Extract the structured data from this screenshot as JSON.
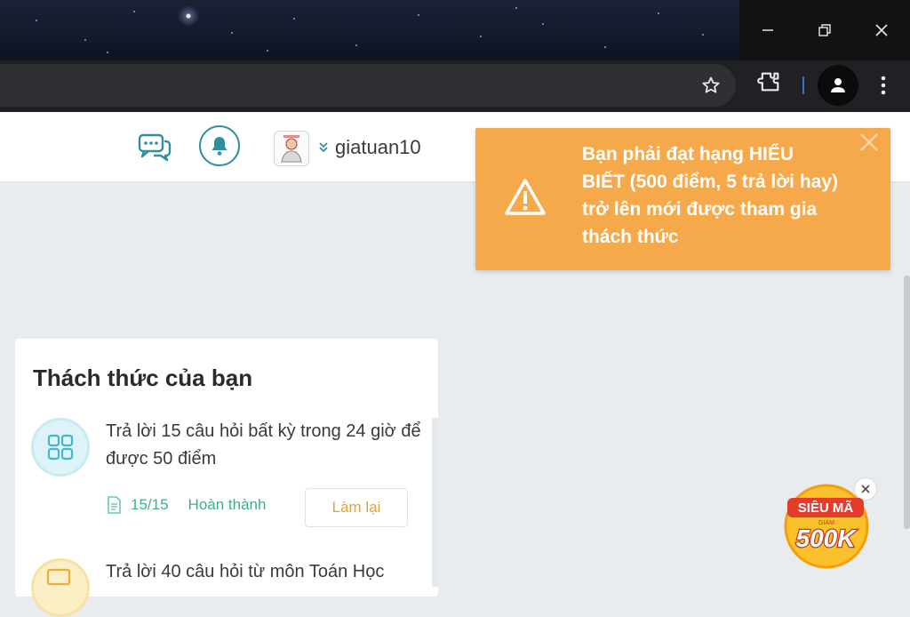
{
  "browser": {
    "window_controls": [
      "minimize",
      "restore",
      "close"
    ],
    "toolbar_icons": [
      "star-icon",
      "extensions-icon",
      "profile-icon",
      "menu-icon"
    ]
  },
  "header": {
    "username": "giatuan10",
    "icons": [
      "chat-icon",
      "bell-icon",
      "avatar",
      "double-chevron-down-icon"
    ]
  },
  "toast": {
    "message": "Bạn phải đạt hạng HIỂU BIẾT (500 điểm, 5 trả lời hay) trở lên mới được tham gia thách thức",
    "color": "#f5a94a"
  },
  "challenges": {
    "title": "Thách thức của bạn",
    "items": [
      {
        "text": "Trả lời 15 câu hỏi  bất kỳ  trong 24 giờ để được 50 điểm",
        "progress": "15/15",
        "status": "Hoàn thành",
        "button": "Làm lại"
      },
      {
        "text": "Trả lời 40 câu hỏi  từ môn Toán Học"
      }
    ]
  },
  "promo": {
    "line1": "SIÊU MÃ",
    "line2": "GIẢM",
    "amount": "500K"
  },
  "colors": {
    "accent": "#2f8f9d",
    "success": "#3cae8e",
    "warning": "#f5a94a",
    "button_text": "#e0a33a"
  }
}
